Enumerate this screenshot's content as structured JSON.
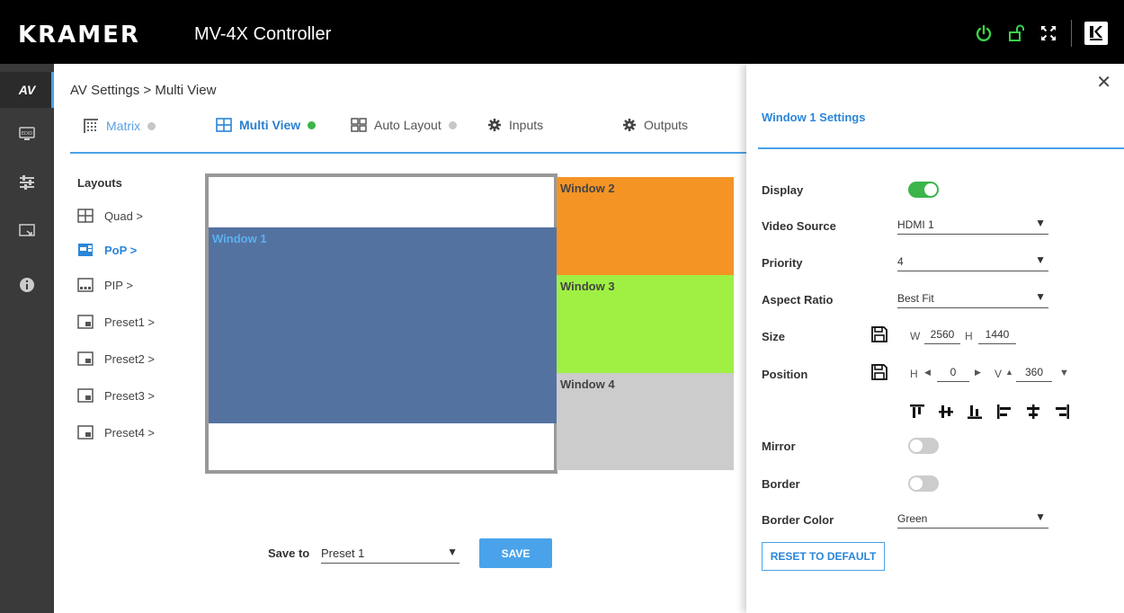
{
  "header": {
    "brand": "KRAMER",
    "title": "MV-4X Controller",
    "icons": [
      "power-icon",
      "unlock-icon",
      "fullscreen-icon",
      "kramer-logo"
    ]
  },
  "sidebar": {
    "items": [
      {
        "name": "av",
        "label": "AV"
      },
      {
        "name": "edid",
        "icon": "edid-icon"
      },
      {
        "name": "settings",
        "icon": "settings-icon"
      },
      {
        "name": "display",
        "icon": "display-icon"
      },
      {
        "name": "info",
        "icon": "info-icon"
      }
    ]
  },
  "breadcrumb": "AV Settings > Multi View",
  "tabs": [
    {
      "label": "Matrix",
      "status": "off"
    },
    {
      "label": "Multi View",
      "status": "on"
    },
    {
      "label": "Auto Layout",
      "status": "off"
    },
    {
      "label": "Inputs"
    },
    {
      "label": "Outputs"
    }
  ],
  "layouts": {
    "title": "Layouts",
    "items": [
      {
        "label": "Quad >"
      },
      {
        "label": "PoP >",
        "active": true
      },
      {
        "label": "PIP >"
      },
      {
        "label": "Preset1 >"
      },
      {
        "label": "Preset2 >"
      },
      {
        "label": "Preset3 >"
      },
      {
        "label": "Preset4 >"
      }
    ]
  },
  "windows": [
    {
      "label": "Window 1",
      "color": "#5472a0",
      "label_color": "#5ab0f0"
    },
    {
      "label": "Window 2",
      "color": "#f39425",
      "label_color": "#444444"
    },
    {
      "label": "Window 3",
      "color": "#9ff043",
      "label_color": "#444444"
    },
    {
      "label": "Window 4",
      "color": "#cccccc",
      "label_color": "#444444"
    }
  ],
  "save": {
    "label": "Save to",
    "selected": "Preset 1",
    "button": "SAVE"
  },
  "panel": {
    "title": "Window 1 Settings",
    "display_label": "Display",
    "display_on": true,
    "video_source_label": "Video Source",
    "video_source": "HDMI 1",
    "priority_label": "Priority",
    "priority": "4",
    "aspect_label": "Aspect Ratio",
    "aspect": "Best Fit",
    "size_label": "Size",
    "size_w_label": "W",
    "size_w": "2560",
    "size_h_label": "H",
    "size_h": "1440",
    "position_label": "Position",
    "pos_h_label": "H",
    "pos_h": "0",
    "pos_v_label": "V",
    "pos_v": "360",
    "mirror_label": "Mirror",
    "mirror_on": false,
    "border_label": "Border",
    "border_on": false,
    "border_color_label": "Border Color",
    "border_color": "Green",
    "reset_button": "RESET TO DEFAULT"
  },
  "colors": {
    "accent": "#4aa3ea",
    "green": "#3bb54a",
    "sidebar": "#3a3a3a"
  }
}
